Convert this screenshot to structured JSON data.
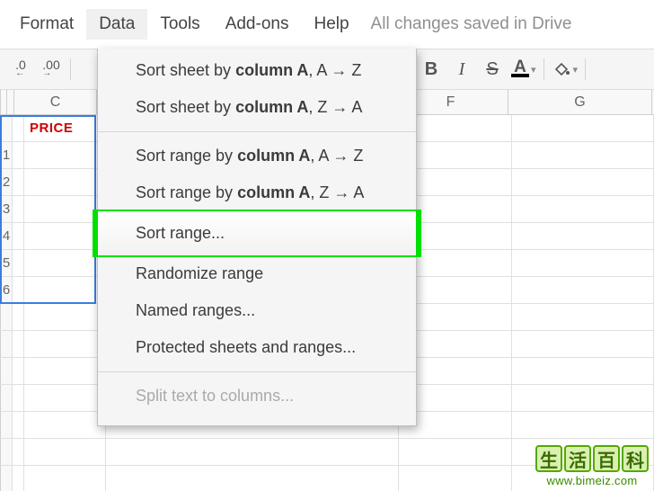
{
  "menubar": {
    "items": [
      "Format",
      "Data",
      "Tools",
      "Add-ons",
      "Help"
    ],
    "active_index": 1,
    "save_status": "All changes saved in Drive"
  },
  "toolbar": {
    "dec_less": ".0",
    "dec_more": ".00",
    "bold": "B",
    "italic": "I",
    "strike": "S",
    "textcolor": "A"
  },
  "columns": {
    "c": "C",
    "f": "F",
    "g": "G"
  },
  "cells": {
    "price_label": "PRICE"
  },
  "rows": [
    "1",
    "2",
    "3",
    "4",
    "5",
    "6"
  ],
  "dropdown": {
    "sort_sheet_az_pre": "Sort sheet by ",
    "sort_sheet_az_col": "column A",
    "sort_sheet_az_suf": ", A → Z",
    "sort_sheet_za_pre": "Sort sheet by ",
    "sort_sheet_za_col": "column A",
    "sort_sheet_za_suf": ", Z → A",
    "sort_range_az_pre": "Sort range by ",
    "sort_range_az_col": "column A",
    "sort_range_az_suf": ", A → Z",
    "sort_range_za_pre": "Sort range by ",
    "sort_range_za_col": "column A",
    "sort_range_za_suf": ", Z → A",
    "sort_range": "Sort range...",
    "randomize": "Randomize range",
    "named_ranges": "Named ranges...",
    "protected": "Protected sheets and ranges...",
    "split_text": "Split text to columns..."
  },
  "watermark": {
    "chars": [
      "生",
      "活",
      "百",
      "科"
    ],
    "url": "www.bimeiz.com"
  }
}
